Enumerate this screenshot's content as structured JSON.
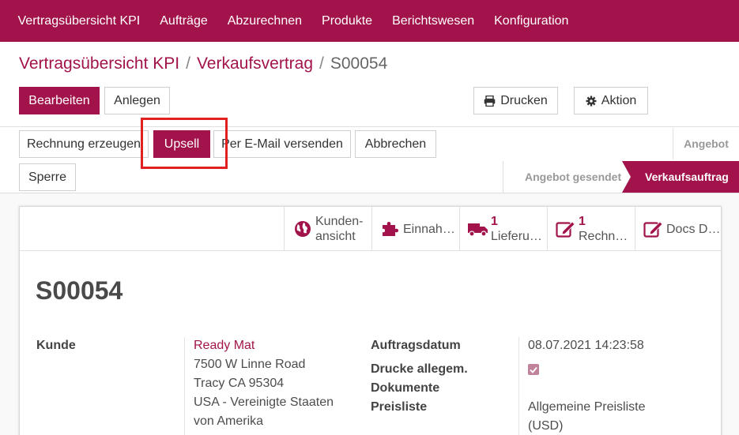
{
  "nav": {
    "items": [
      "Vertragsübersicht KPI",
      "Aufträge",
      "Abzurechnen",
      "Produkte",
      "Berichtswesen",
      "Konfiguration"
    ]
  },
  "breadcrumb": {
    "part1": "Vertragsübersicht KPI",
    "sep": "/",
    "part2": "Verkaufsvertrag",
    "current": "S00054"
  },
  "toolbar": {
    "edit": "Bearbeiten",
    "create": "Anlegen",
    "print": "Drucken",
    "action": "Aktion",
    "print_icon": "printer-icon",
    "action_icon": "gear-icon"
  },
  "actions": {
    "invoice": "Rechnung erzeugen",
    "upsell": "Upsell",
    "email": "Per E-Mail versenden",
    "cancel": "Abbrechen",
    "lock": "Sperre"
  },
  "status": {
    "top": "Angebot",
    "sent": "Angebot gesendet",
    "active": "Verkaufsauftrag"
  },
  "smart_buttons": {
    "customer_line1": "Kunden-",
    "customer_line2": "ansicht",
    "income": "Einnah…",
    "delivery_count": "1",
    "delivery": "Lieferu…",
    "invoice_count": "1",
    "invoice": "Rechn…",
    "docs": "Docs D…"
  },
  "record": {
    "name": "S00054",
    "customer_label": "Kunde",
    "customer_name": "Ready Mat",
    "address1": "7500 W Linne Road",
    "address2": "Tracy CA 95304",
    "address3": "USA - Vereinigte Staaten",
    "address4": "von Amerika",
    "date_label": "Auftragsdatum",
    "date_value": "08.07.2021 14:23:58",
    "print_docs_label1": "Drucke allegem.",
    "print_docs_label2": "Dokumente",
    "print_docs_checked": true,
    "pricelist_label": "Preisliste",
    "pricelist_value1": "Allgemeine Preisliste",
    "pricelist_value2": "(USD)"
  },
  "colors": {
    "brand": "#a2134b",
    "highlight": "#e0211f"
  }
}
